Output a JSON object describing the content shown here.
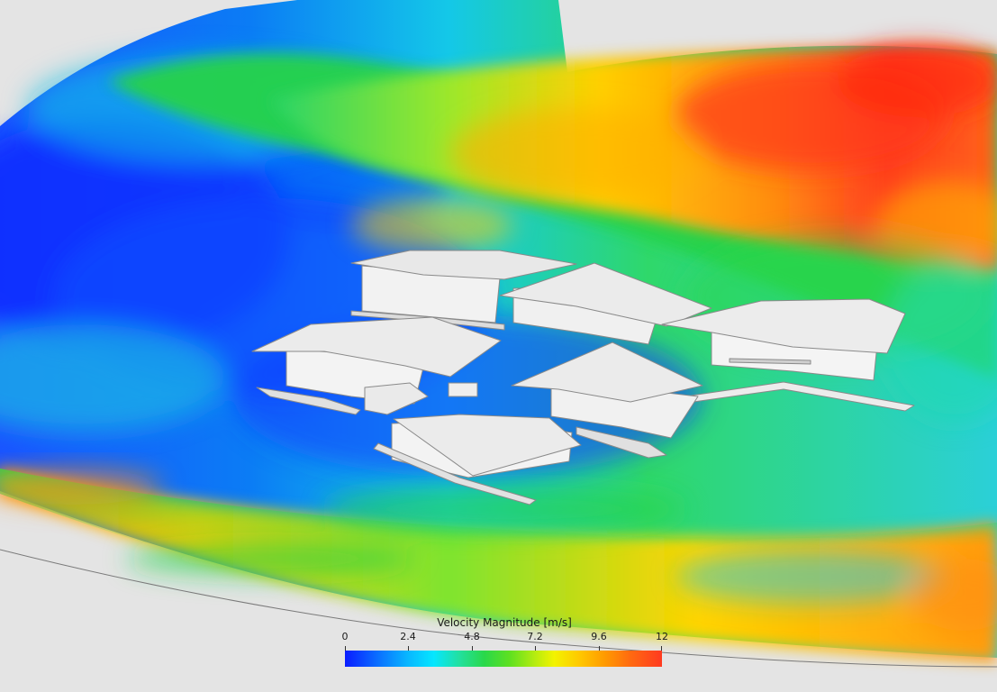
{
  "legend": {
    "title": "Velocity Magnitude [m/s]",
    "ticks": [
      "0",
      "2.4",
      "4.8",
      "7.2",
      "9.6",
      "12"
    ],
    "colormap": [
      "#0a1cff",
      "#08b8ff",
      "#2ad84a",
      "#f3f300",
      "#ff9a00",
      "#ff3a20"
    ]
  },
  "colors": {
    "background": "#e4e4e4",
    "building": "#f2f2f2",
    "building_shadow": "#d8d8d8"
  }
}
